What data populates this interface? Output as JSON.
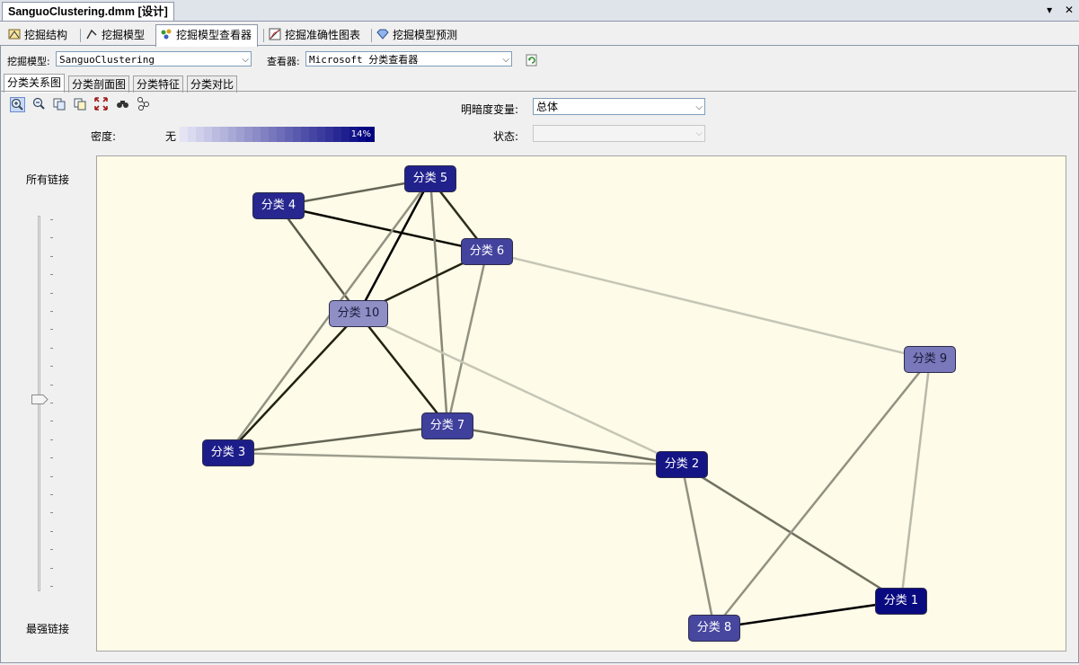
{
  "document": {
    "tab_title": "SanguoClustering.dmm [设计]",
    "pin_glyph": "▾",
    "close_glyph": "✕"
  },
  "main_tabs": [
    {
      "label": "挖掘结构"
    },
    {
      "label": "挖掘模型"
    },
    {
      "label": "挖掘模型查看器",
      "active": true
    },
    {
      "label": "挖掘准确性图表"
    },
    {
      "label": "挖掘模型预测"
    }
  ],
  "toolbar": {
    "model_label": "挖掘模型:",
    "model_value": "SanguoClustering",
    "viewer_label": "查看器:",
    "viewer_value": "Microsoft 分类查看器",
    "refresh_icon": "refresh-icon"
  },
  "sub_tabs": [
    {
      "label": "分类关系图",
      "active": true
    },
    {
      "label": "分类剖面图"
    },
    {
      "label": "分类特征"
    },
    {
      "label": "分类对比"
    }
  ],
  "controls": {
    "shading_label": "明暗度变量:",
    "shading_value": "总体",
    "state_label": "状态:",
    "state_value": "",
    "density_label": "密度:",
    "density_min": "无",
    "density_max": "14%"
  },
  "slider": {
    "top_label": "所有链接",
    "bottom_label": "最强链接",
    "position": 0.5
  },
  "colors": {
    "canvas_bg": "#fefbe8",
    "accent": "#000080",
    "density_max": "#000080"
  },
  "nodes": [
    {
      "id": "1",
      "label": "分类 1",
      "shade": 1.0
    },
    {
      "id": "2",
      "label": "分类 2",
      "shade": 0.95
    },
    {
      "id": "3",
      "label": "分类 3",
      "shade": 0.9
    },
    {
      "id": "4",
      "label": "分类 4",
      "shade": 0.85
    },
    {
      "id": "5",
      "label": "分类 5",
      "shade": 0.88
    },
    {
      "id": "6",
      "label": "分类 6",
      "shade": 0.7
    },
    {
      "id": "7",
      "label": "分类 7",
      "shade": 0.72
    },
    {
      "id": "8",
      "label": "分类 8",
      "shade": 0.68
    },
    {
      "id": "9",
      "label": "分类 9",
      "shade": 0.42
    },
    {
      "id": "10",
      "label": "分类 10",
      "shade": 0.3
    }
  ],
  "links": [
    {
      "from": "4",
      "to": "5",
      "strength": 0.55
    },
    {
      "from": "4",
      "to": "6",
      "strength": 0.95
    },
    {
      "from": "4",
      "to": "10",
      "strength": 0.6
    },
    {
      "from": "5",
      "to": "6",
      "strength": 0.8
    },
    {
      "from": "5",
      "to": "10",
      "strength": 1.0
    },
    {
      "from": "5",
      "to": "7",
      "strength": 0.4
    },
    {
      "from": "5",
      "to": "3",
      "strength": 0.35
    },
    {
      "from": "6",
      "to": "10",
      "strength": 0.85
    },
    {
      "from": "6",
      "to": "7",
      "strength": 0.35
    },
    {
      "from": "6",
      "to": "9",
      "strength": 0.12
    },
    {
      "from": "10",
      "to": "3",
      "strength": 0.85
    },
    {
      "from": "10",
      "to": "7",
      "strength": 0.85
    },
    {
      "from": "10",
      "to": "2",
      "strength": 0.12
    },
    {
      "from": "3",
      "to": "7",
      "strength": 0.55
    },
    {
      "from": "3",
      "to": "2",
      "strength": 0.3
    },
    {
      "from": "7",
      "to": "2",
      "strength": 0.5
    },
    {
      "from": "2",
      "to": "1",
      "strength": 0.5
    },
    {
      "from": "2",
      "to": "8",
      "strength": 0.35
    },
    {
      "from": "8",
      "to": "1",
      "strength": 1.0
    },
    {
      "from": "8",
      "to": "9",
      "strength": 0.35
    },
    {
      "from": "9",
      "to": "1",
      "strength": 0.18
    }
  ]
}
